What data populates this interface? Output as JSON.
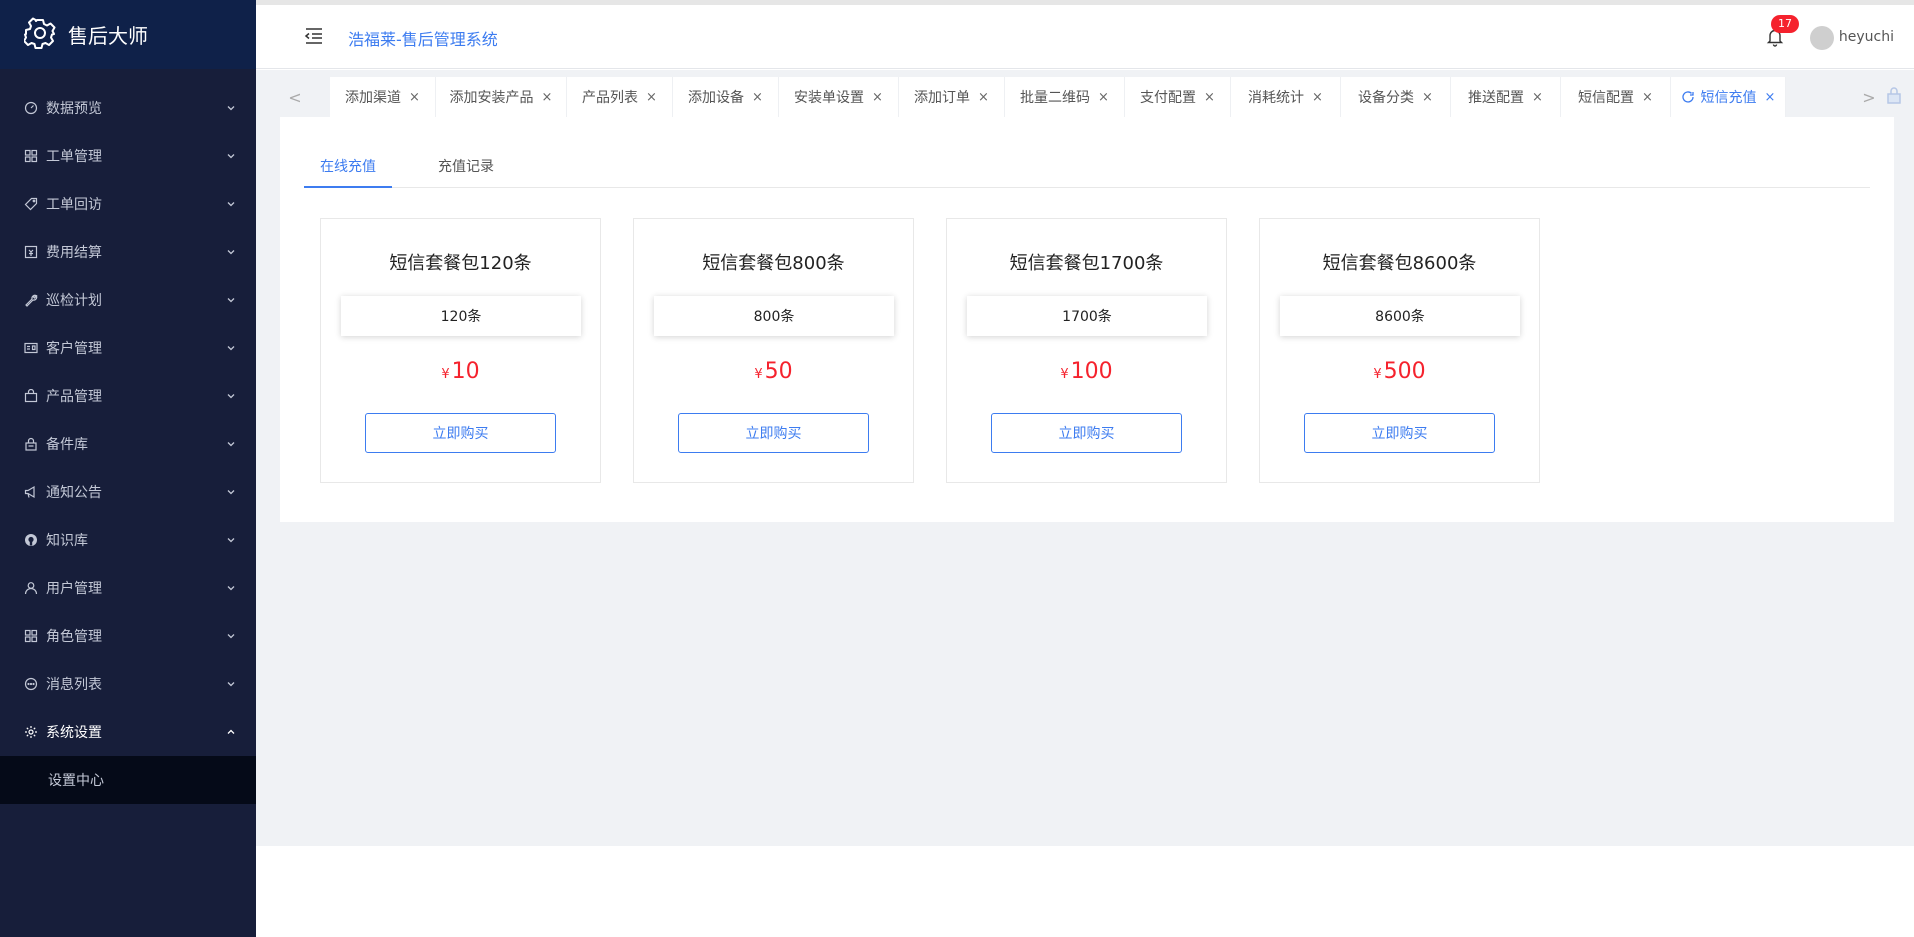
{
  "app": {
    "logo_text": "售后大师",
    "system_title": "浩福莱-售后管理系统"
  },
  "sidebar": {
    "items": [
      {
        "label": "数据预览",
        "icon": "dashboard-icon"
      },
      {
        "label": "工单管理",
        "icon": "grid-icon"
      },
      {
        "label": "工单回访",
        "icon": "tag-icon"
      },
      {
        "label": "费用结算",
        "icon": "receipt-icon"
      },
      {
        "label": "巡检计划",
        "icon": "wrench-icon"
      },
      {
        "label": "客户管理",
        "icon": "id-card-icon"
      },
      {
        "label": "产品管理",
        "icon": "bag-icon"
      },
      {
        "label": "备件库",
        "icon": "lock-icon"
      },
      {
        "label": "通知公告",
        "icon": "megaphone-icon"
      },
      {
        "label": "知识库",
        "icon": "github-icon"
      },
      {
        "label": "用户管理",
        "icon": "user-icon"
      },
      {
        "label": "角色管理",
        "icon": "grid-icon"
      },
      {
        "label": "消息列表",
        "icon": "message-icon"
      },
      {
        "label": "系统设置",
        "icon": "gear-icon"
      }
    ],
    "submenu": {
      "label": "设置中心"
    }
  },
  "header": {
    "notification_count": "17",
    "username": "heyuchi"
  },
  "tabs": [
    {
      "label": "添加渠道",
      "close": "×"
    },
    {
      "label": "添加安装产品",
      "close": "×"
    },
    {
      "label": "产品列表",
      "close": "×"
    },
    {
      "label": "添加设备",
      "close": "×"
    },
    {
      "label": "安装单设置",
      "close": "×"
    },
    {
      "label": "添加订单",
      "close": "×"
    },
    {
      "label": "批量二维码",
      "close": "×"
    },
    {
      "label": "支付配置",
      "close": "×"
    },
    {
      "label": "消耗统计",
      "close": "×"
    },
    {
      "label": "设备分类",
      "close": "×"
    },
    {
      "label": "推送配置",
      "close": "×"
    },
    {
      "label": "短信配置",
      "close": "×"
    },
    {
      "label": "短信充值",
      "close": "×",
      "active": true
    }
  ],
  "tab_nav": {
    "left": "<",
    "right": ">"
  },
  "sub_tabs": [
    {
      "label": "在线充值",
      "active": true
    },
    {
      "label": "充值记录"
    }
  ],
  "packages": [
    {
      "title": "短信套餐包120条",
      "quantity": "120条",
      "currency": "¥",
      "price": "10",
      "button": "立即购买"
    },
    {
      "title": "短信套餐包800条",
      "quantity": "800条",
      "currency": "¥",
      "price": "50",
      "button": "立即购买"
    },
    {
      "title": "短信套餐包1700条",
      "quantity": "1700条",
      "currency": "¥",
      "price": "100",
      "button": "立即购买"
    },
    {
      "title": "短信套餐包8600条",
      "quantity": "8600条",
      "currency": "¥",
      "price": "500",
      "button": "立即购买"
    }
  ],
  "colors": {
    "sidebar_bg": "#171e3a",
    "logo_bg": "#0f2149",
    "accent": "#3d7cf0",
    "price": "#f5222d",
    "badge": "#f5222d"
  }
}
